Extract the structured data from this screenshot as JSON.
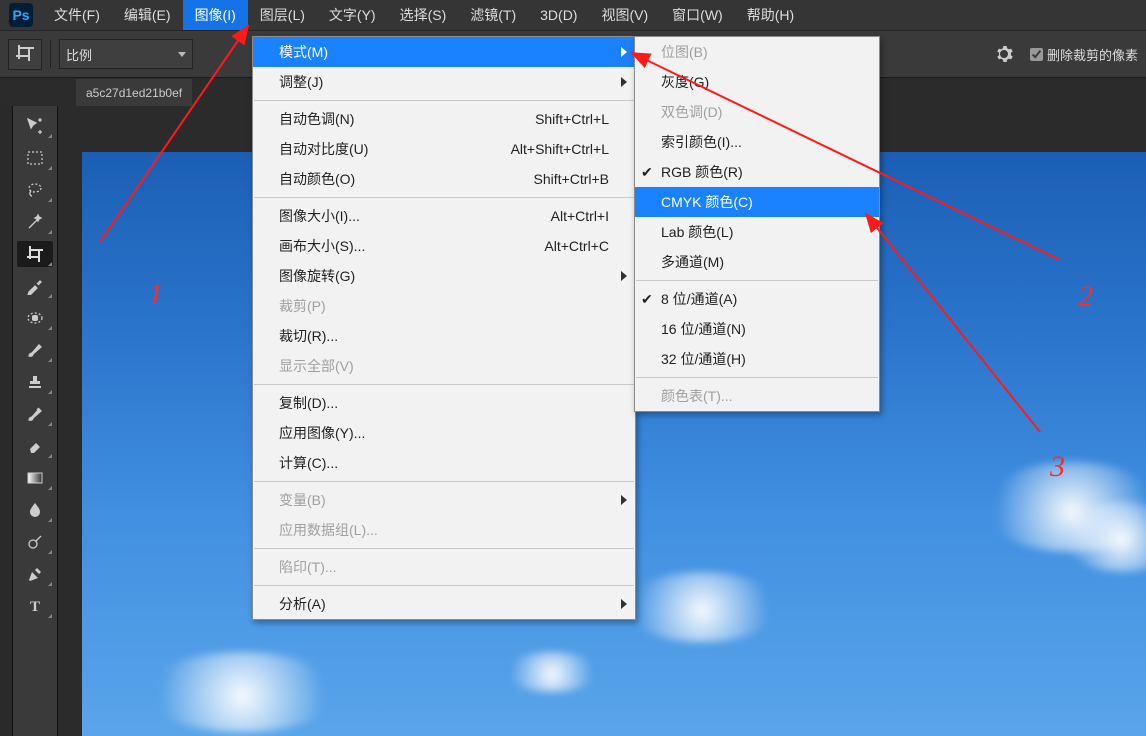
{
  "menubar": {
    "items": [
      "文件(F)",
      "编辑(E)",
      "图像(I)",
      "图层(L)",
      "文字(Y)",
      "选择(S)",
      "滤镜(T)",
      "3D(D)",
      "视图(V)",
      "窗口(W)",
      "帮助(H)"
    ],
    "active_index": 2
  },
  "optionbar": {
    "ratio_label": "比例",
    "delete_crop_label": "删除裁剪的像素",
    "delete_crop_checked": true
  },
  "doc_tab": "a5c27d1ed21b0ef",
  "image_menu": [
    {
      "label": "模式(M)",
      "submenu": true,
      "highlight": true
    },
    {
      "label": "调整(J)",
      "submenu": true
    },
    {
      "sep": true
    },
    {
      "label": "自动色调(N)",
      "shortcut": "Shift+Ctrl+L"
    },
    {
      "label": "自动对比度(U)",
      "shortcut": "Alt+Shift+Ctrl+L"
    },
    {
      "label": "自动颜色(O)",
      "shortcut": "Shift+Ctrl+B"
    },
    {
      "sep": true
    },
    {
      "label": "图像大小(I)...",
      "shortcut": "Alt+Ctrl+I"
    },
    {
      "label": "画布大小(S)...",
      "shortcut": "Alt+Ctrl+C"
    },
    {
      "label": "图像旋转(G)",
      "submenu": true
    },
    {
      "label": "裁剪(P)",
      "disabled": true
    },
    {
      "label": "裁切(R)..."
    },
    {
      "label": "显示全部(V)",
      "disabled": true
    },
    {
      "sep": true
    },
    {
      "label": "复制(D)..."
    },
    {
      "label": "应用图像(Y)..."
    },
    {
      "label": "计算(C)..."
    },
    {
      "sep": true
    },
    {
      "label": "变量(B)",
      "submenu": true,
      "disabled": true
    },
    {
      "label": "应用数据组(L)...",
      "disabled": true
    },
    {
      "sep": true
    },
    {
      "label": "陷印(T)...",
      "disabled": true
    },
    {
      "sep": true
    },
    {
      "label": "分析(A)",
      "submenu": true
    }
  ],
  "mode_submenu": [
    {
      "label": "位图(B)",
      "disabled": true
    },
    {
      "label": "灰度(G)"
    },
    {
      "label": "双色调(D)",
      "disabled": true
    },
    {
      "label": "索引颜色(I)..."
    },
    {
      "label": "RGB 颜色(R)",
      "checked": true
    },
    {
      "label": "CMYK 颜色(C)",
      "highlight": true
    },
    {
      "label": "Lab 颜色(L)"
    },
    {
      "label": "多通道(M)"
    },
    {
      "sep": true
    },
    {
      "label": "8 位/通道(A)",
      "checked": true
    },
    {
      "label": "16 位/通道(N)"
    },
    {
      "label": "32 位/通道(H)"
    },
    {
      "sep": true
    },
    {
      "label": "颜色表(T)...",
      "disabled": true
    }
  ],
  "annotations": {
    "a1": "1",
    "a2": "2",
    "a3": "3"
  }
}
